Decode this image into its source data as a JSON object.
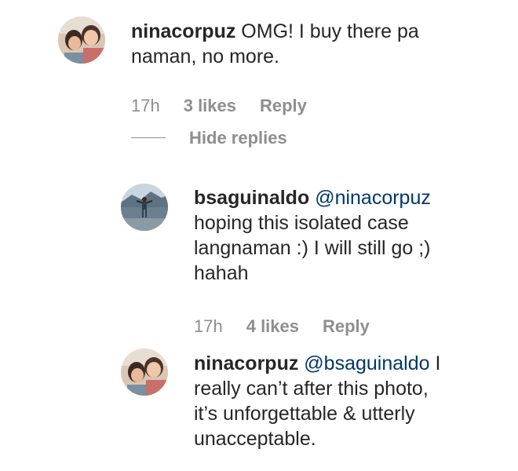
{
  "comments": [
    {
      "username": "ninacorpuz",
      "mention": "",
      "lines": [
        "OMG! I buy there pa",
        "naman, no more."
      ],
      "time": "17h",
      "likes": "3 likes",
      "reply_label": "Reply"
    },
    {
      "username": "bsaguinaldo",
      "mention": "@ninacorpuz",
      "lines": [
        "hoping this isolated case",
        "langnaman :) I will still go ;)",
        "hahah"
      ],
      "time": "17h",
      "likes": "4 likes",
      "reply_label": "Reply"
    },
    {
      "username": "ninacorpuz",
      "mention": "@bsaguinaldo",
      "lines": [
        "I",
        "really can’t after this photo,",
        "it’s unforgettable & utterly",
        "unacceptable."
      ]
    }
  ],
  "hide_replies_label": "Hide replies",
  "colors": {
    "text": "#262626",
    "meta": "#8e8e8e",
    "mention": "#00376b"
  }
}
